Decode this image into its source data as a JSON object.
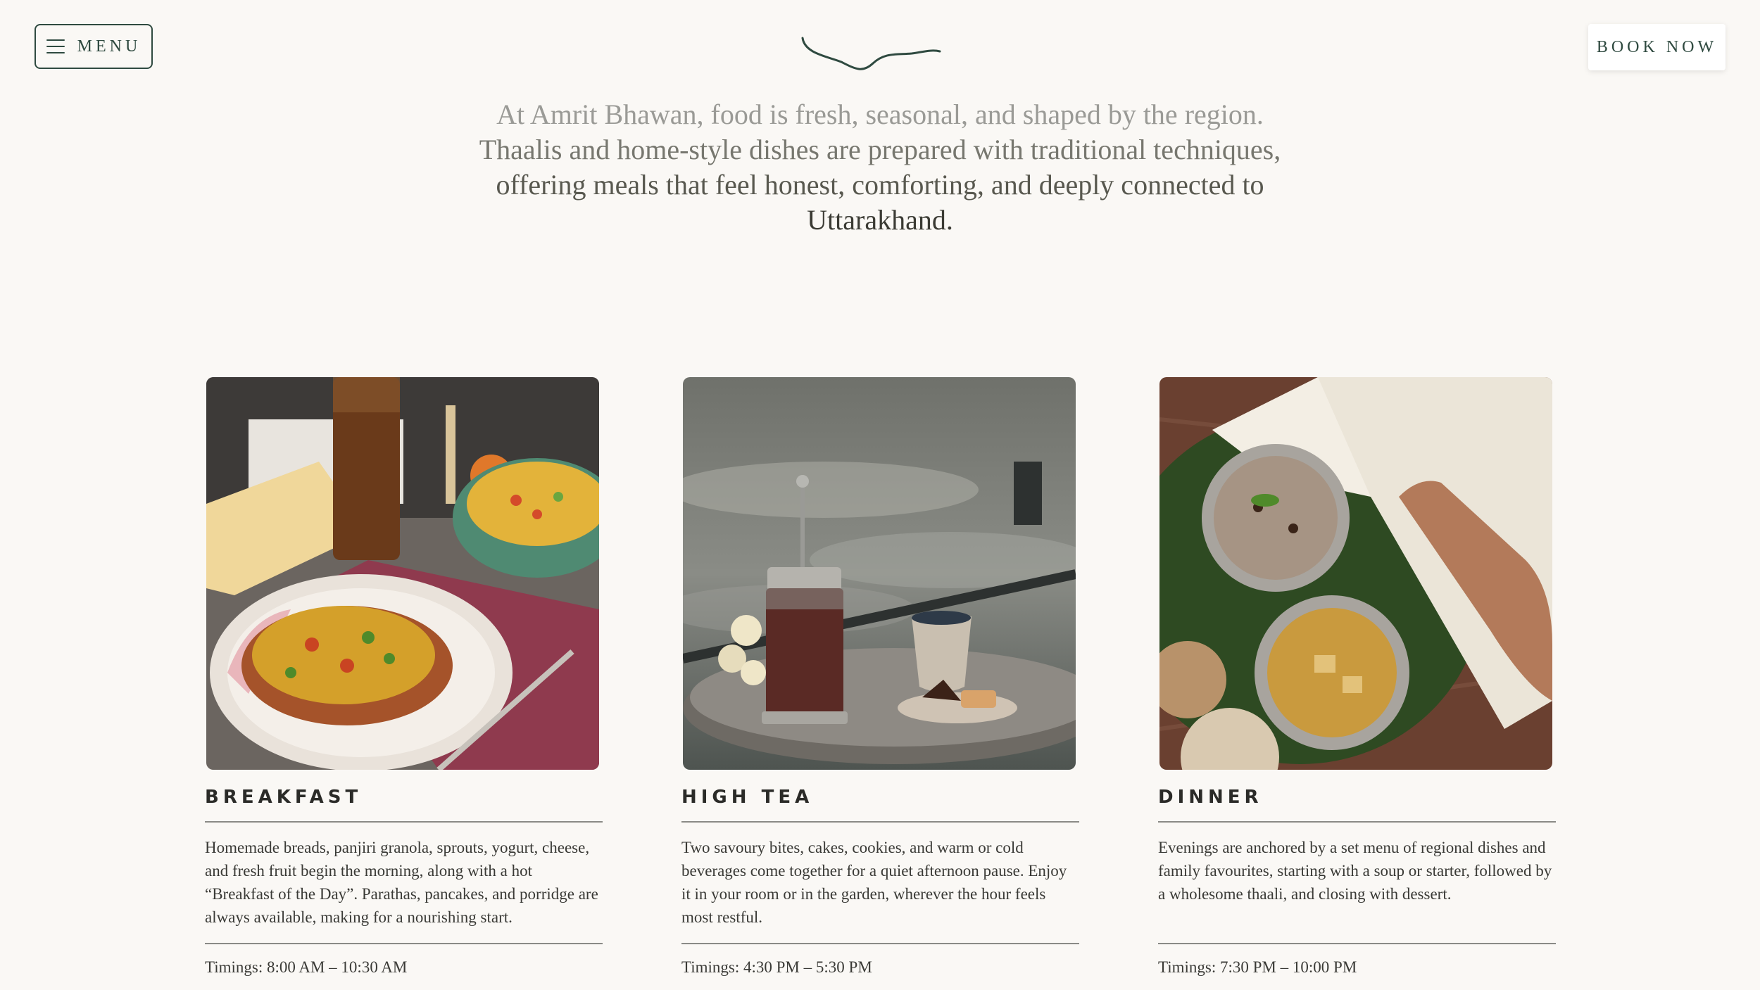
{
  "header": {
    "menu_label": "MENU",
    "book_label": "BOOK NOW"
  },
  "intro": {
    "line1": "At Amrit Bhawan, food is fresh, seasonal, and shaped by the region.",
    "line2": "Thaalis and home-style dishes are prepared with traditional techniques,",
    "line3": "offering meals that feel honest, comforting, and deeply connected to",
    "line4": "Uttarakhand."
  },
  "meals": [
    {
      "title": "BREAKFAST",
      "description": "Homemade breads, panjiri granola, sprouts, yogurt, cheese, and fresh fruit begin the morning, along with a hot “Breakfast of the Day”. Parathas, pancakes, and porridge are always available, making for a nourishing start.",
      "timing": "Timings: 8:00 AM – 10:30 AM"
    },
    {
      "title": "HIGH TEA",
      "description": "Two savoury bites, cakes, cookies, and warm or cold beverages come together for a quiet afternoon pause. Enjoy it in your room or in the garden, wherever the hour feels most restful.",
      "timing": "Timings: 4:30 PM – 5:30 PM"
    },
    {
      "title": "DINNER",
      "description": "Evenings are anchored by a set menu of regional dishes and family favourites, starting with a soup or starter, followed by a wholesome thaali, and closing with dessert.",
      "timing": "Timings: 7:30 PM – 10:00 PM"
    }
  ],
  "colors": {
    "background": "#faf8f5",
    "accent": "#2f4a40",
    "text": "#3a3a36"
  }
}
